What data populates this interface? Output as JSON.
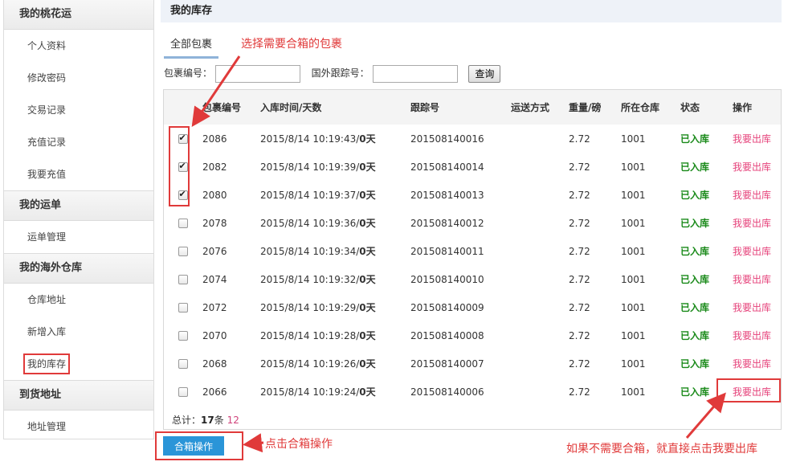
{
  "sidebar": {
    "sections": [
      {
        "title": "我的桃花运",
        "items": [
          "个人资料",
          "修改密码",
          "交易记录",
          "充值记录",
          "我要充值"
        ]
      },
      {
        "title": "我的运单",
        "items": [
          "运单管理"
        ]
      },
      {
        "title": "我的海外仓库",
        "items": [
          "仓库地址",
          "新增入库",
          "我的库存"
        ]
      },
      {
        "title": "到货地址",
        "items": [
          "地址管理"
        ]
      }
    ]
  },
  "main": {
    "title": "我的库存",
    "tab": "全部包裹",
    "filters": {
      "package_no_label": "包裹编号：",
      "tracking_label": "国外跟踪号：",
      "query_button": "查询"
    },
    "table": {
      "headers": [
        "包裹编号",
        "入库时间/天数",
        "跟踪号",
        "运送方式",
        "重量/磅",
        "所在仓库",
        "状态",
        "操作"
      ],
      "rows": [
        {
          "checked": true,
          "id": "2086",
          "time": "2015/8/14 10:19:43/",
          "days": "0天",
          "tracking": "201508140016",
          "method": "",
          "weight": "2.72",
          "warehouse": "1001",
          "status": "已入库",
          "action": "我要出库"
        },
        {
          "checked": true,
          "id": "2082",
          "time": "2015/8/14 10:19:39/",
          "days": "0天",
          "tracking": "201508140014",
          "method": "",
          "weight": "2.72",
          "warehouse": "1001",
          "status": "已入库",
          "action": "我要出库"
        },
        {
          "checked": true,
          "id": "2080",
          "time": "2015/8/14 10:19:37/",
          "days": "0天",
          "tracking": "201508140013",
          "method": "",
          "weight": "2.72",
          "warehouse": "1001",
          "status": "已入库",
          "action": "我要出库"
        },
        {
          "checked": false,
          "id": "2078",
          "time": "2015/8/14 10:19:36/",
          "days": "0天",
          "tracking": "201508140012",
          "method": "",
          "weight": "2.72",
          "warehouse": "1001",
          "status": "已入库",
          "action": "我要出库"
        },
        {
          "checked": false,
          "id": "2076",
          "time": "2015/8/14 10:19:34/",
          "days": "0天",
          "tracking": "201508140011",
          "method": "",
          "weight": "2.72",
          "warehouse": "1001",
          "status": "已入库",
          "action": "我要出库"
        },
        {
          "checked": false,
          "id": "2074",
          "time": "2015/8/14 10:19:32/",
          "days": "0天",
          "tracking": "201508140010",
          "method": "",
          "weight": "2.72",
          "warehouse": "1001",
          "status": "已入库",
          "action": "我要出库"
        },
        {
          "checked": false,
          "id": "2072",
          "time": "2015/8/14 10:19:29/",
          "days": "0天",
          "tracking": "201508140009",
          "method": "",
          "weight": "2.72",
          "warehouse": "1001",
          "status": "已入库",
          "action": "我要出库"
        },
        {
          "checked": false,
          "id": "2070",
          "time": "2015/8/14 10:19:28/",
          "days": "0天",
          "tracking": "201508140008",
          "method": "",
          "weight": "2.72",
          "warehouse": "1001",
          "status": "已入库",
          "action": "我要出库"
        },
        {
          "checked": false,
          "id": "2068",
          "time": "2015/8/14 10:19:26/",
          "days": "0天",
          "tracking": "201508140007",
          "method": "",
          "weight": "2.72",
          "warehouse": "1001",
          "status": "已入库",
          "action": "我要出库"
        },
        {
          "checked": false,
          "id": "2066",
          "time": "2015/8/14 10:19:24/",
          "days": "0天",
          "tracking": "201508140006",
          "method": "",
          "weight": "2.72",
          "warehouse": "1001",
          "status": "已入库",
          "action": "我要出库"
        }
      ]
    },
    "total": {
      "prefix": "总计：",
      "count": "17",
      "unit": "条",
      "page1": "1",
      "page2": "2"
    },
    "merge_button": "合箱操作"
  },
  "annotations": {
    "select_packages": "选择需要合箱的包裹",
    "click_merge": "点击合箱操作",
    "direct_ship": "如果不需要合箱，就直接点击我要出库"
  },
  "colors": {
    "accent": "#2a95d8",
    "annotation": "#e03a3a",
    "status": "#1a8a1a",
    "action": "#e6437b"
  }
}
